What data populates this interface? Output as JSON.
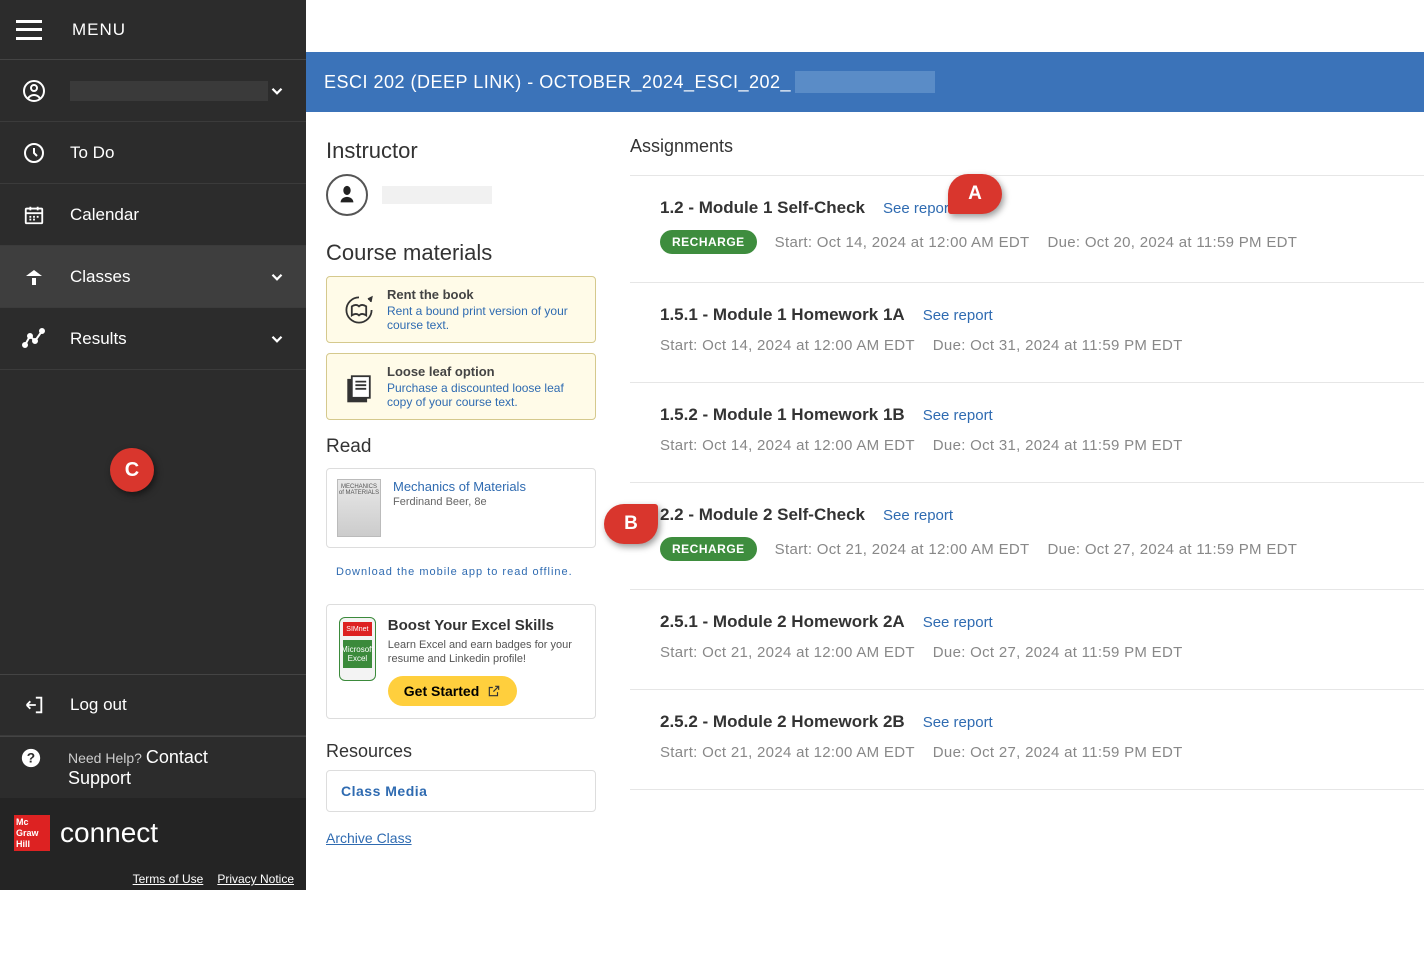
{
  "menu": {
    "label": "MENU",
    "items": [
      {
        "icon": "user",
        "label": "",
        "chevron": true
      },
      {
        "icon": "clock",
        "label": "To Do"
      },
      {
        "icon": "calendar",
        "label": "Calendar"
      },
      {
        "icon": "lamp",
        "label": "Classes",
        "chevron": true,
        "active": true
      },
      {
        "icon": "results",
        "label": "Results",
        "chevron": true
      }
    ],
    "logout": "Log out",
    "help_title": "Need Help?",
    "help_contact": "Contact Support",
    "brand_box": "Mc\nGraw\nHill",
    "brand_text": "connect",
    "terms": "Terms of Use",
    "privacy": "Privacy Notice"
  },
  "course_header": "ESCI 202 (DEEP LINK) - OCTOBER_2024_ESCI_202_",
  "left": {
    "instructor_h": "Instructor",
    "materials_h": "Course materials",
    "rent_title": "Rent the book",
    "rent_sub": "Rent a bound print version of your course text.",
    "loose_title": "Loose leaf option",
    "loose_sub": "Purchase a discounted loose leaf copy of your course text.",
    "read_h": "Read",
    "read_thumb": "MECHANICS of MATERIALS",
    "read_title": "Mechanics of Materials",
    "read_author": "Ferdinand Beer, 8e",
    "read_download": "Download the mobile app to read offline.",
    "simnet_top": "SIMnet",
    "simnet_mid": "Microsoft Excel",
    "simnet_title": "Boost Your Excel Skills",
    "simnet_sub": "Learn Excel and earn badges for your resume and Linkedin profile!",
    "get_started": "Get Started",
    "resources_h": "Resources",
    "class_media": "Class Media",
    "archive": "Archive Class"
  },
  "right": {
    "header": "Assignments",
    "recharge_label": "RECHARGE",
    "see_report": "See report",
    "items": [
      {
        "title": "1.2 - Module 1 Self-Check",
        "recharge": true,
        "start": "Start: Oct 14, 2024 at 12:00 AM EDT",
        "due": "Due: Oct 20, 2024 at 11:59 PM EDT"
      },
      {
        "title": "1.5.1 - Module 1 Homework 1A",
        "start": "Start: Oct 14, 2024 at 12:00 AM EDT",
        "due": "Due: Oct 31, 2024 at 11:59 PM EDT"
      },
      {
        "title": "1.5.2 - Module 1 Homework 1B",
        "start": "Start: Oct 14, 2024 at 12:00 AM EDT",
        "due": "Due: Oct 31, 2024 at 11:59 PM EDT"
      },
      {
        "title": "2.2 - Module 2 Self-Check",
        "recharge": true,
        "start": "Start: Oct 21, 2024 at 12:00 AM EDT",
        "due": "Due: Oct 27, 2024 at 11:59 PM EDT"
      },
      {
        "title": "2.5.1 - Module 2 Homework 2A",
        "start": "Start: Oct 21, 2024 at 12:00 AM EDT",
        "due": "Due: Oct 27, 2024 at 11:59 PM EDT"
      },
      {
        "title": "2.5.2 - Module 2 Homework 2B",
        "start": "Start: Oct 21, 2024 at 12:00 AM EDT",
        "due": "Due: Oct 27, 2024 at 11:59 PM EDT"
      }
    ]
  },
  "callouts": {
    "a": "A",
    "b": "B",
    "c": "C"
  }
}
